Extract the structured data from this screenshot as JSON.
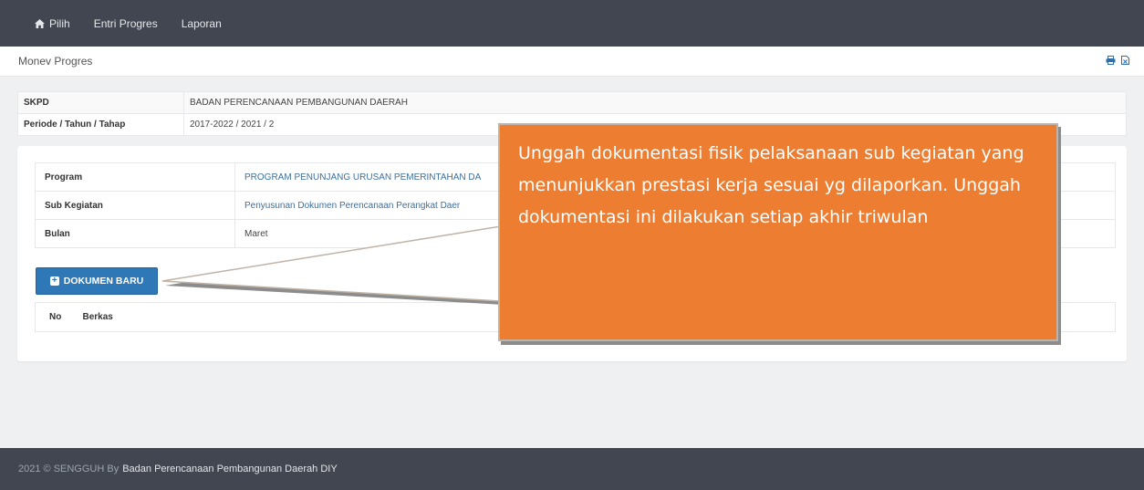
{
  "nav": {
    "items": [
      {
        "label": "Pilih",
        "icon": "home-icon"
      },
      {
        "label": "Entri Progres"
      },
      {
        "label": "Laporan"
      }
    ]
  },
  "page": {
    "title": "Monev Progres",
    "icons": [
      "print-icon",
      "export-file-icon"
    ]
  },
  "info": {
    "rows": [
      {
        "label": "SKPD",
        "value": "BADAN PERENCANAAN PEMBANGUNAN DAERAH"
      },
      {
        "label": "Periode / Tahun / Tahap",
        "value": "2017-2022 / 2021 / 2"
      }
    ]
  },
  "detail": {
    "rows": [
      {
        "label": "Program",
        "value": "PROGRAM PENUNJANG URUSAN PEMERINTAHAN DA"
      },
      {
        "label": "Sub Kegiatan",
        "value": "Penyusunan Dokumen Perencanaan Perangkat Daer"
      },
      {
        "label": "Bulan",
        "value": "Maret"
      }
    ],
    "new_button_label": "DOKUMEN BARU",
    "files_columns": [
      "No",
      "Berkas"
    ]
  },
  "callout": {
    "text": "Unggah dokumentasi fisik pelaksanaan sub kegiatan yang menunjukkan prestasi kerja sesuai yg dilaporkan. Unggah dokumentasi ini dilakukan setiap akhir triwulan"
  },
  "footer": {
    "prefix": "2021 © SENGGUH By",
    "credit": "Badan Perencanaan Pembangunan Daerah DIY"
  },
  "colors": {
    "navbar": "#414650",
    "accent_button": "#2f78b8",
    "callout_fill": "#ed7d31",
    "link_text": "#3d6f9e"
  }
}
